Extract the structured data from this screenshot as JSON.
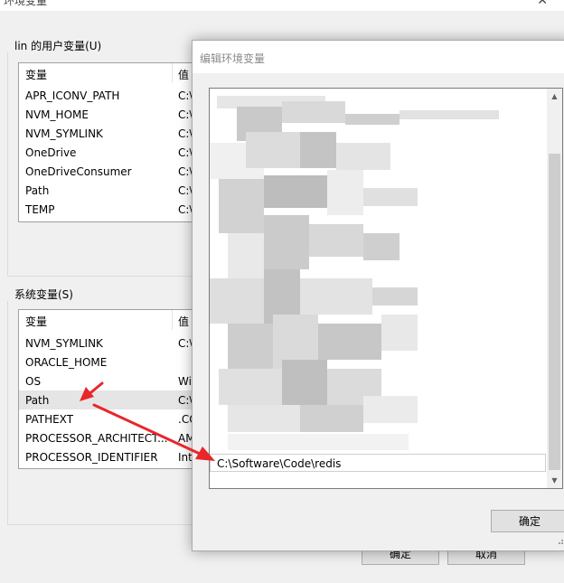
{
  "background_window": {
    "title": "环境变量",
    "close_glyph": "✕",
    "user_group": {
      "label": "lin 的用户变量(U)",
      "columns": [
        "变量",
        "值"
      ],
      "rows": [
        {
          "name": "APR_ICONV_PATH",
          "value": "C:\\"
        },
        {
          "name": "NVM_HOME",
          "value": "C:\\"
        },
        {
          "name": "NVM_SYMLINK",
          "value": "C:\\"
        },
        {
          "name": "OneDrive",
          "value": "C:\\"
        },
        {
          "name": "OneDriveConsumer",
          "value": "C:\\"
        },
        {
          "name": "Path",
          "value": "C:\\"
        },
        {
          "name": "TEMP",
          "value": "C:\\"
        }
      ]
    },
    "system_group": {
      "label": "系统变量(S)",
      "columns": [
        "变量",
        "值"
      ],
      "rows": [
        {
          "name": "NVM_SYMLINK",
          "value": "C:\\"
        },
        {
          "name": "ORACLE_HOME",
          "value": ""
        },
        {
          "name": "OS",
          "value": "Wi"
        },
        {
          "name": "Path",
          "value": "C:\\"
        },
        {
          "name": "PATHEXT",
          "value": ".CO"
        },
        {
          "name": "PROCESSOR_ARCHITECT...",
          "value": "AM"
        },
        {
          "name": "PROCESSOR_IDENTIFIER",
          "value": "Intel"
        }
      ],
      "selected_row": "Path"
    },
    "buttons": {
      "ok": "确定",
      "cancel": "取消"
    }
  },
  "edit_dialog": {
    "title": "编辑环境变量",
    "entries": [
      {
        "text": "C:\\Software\\Code\\redis",
        "selected": true
      }
    ],
    "ok_button": "确定"
  },
  "annotation": {
    "arrow_color": "#e8262b",
    "description": "Path → C:\\Software\\Code\\redis"
  }
}
